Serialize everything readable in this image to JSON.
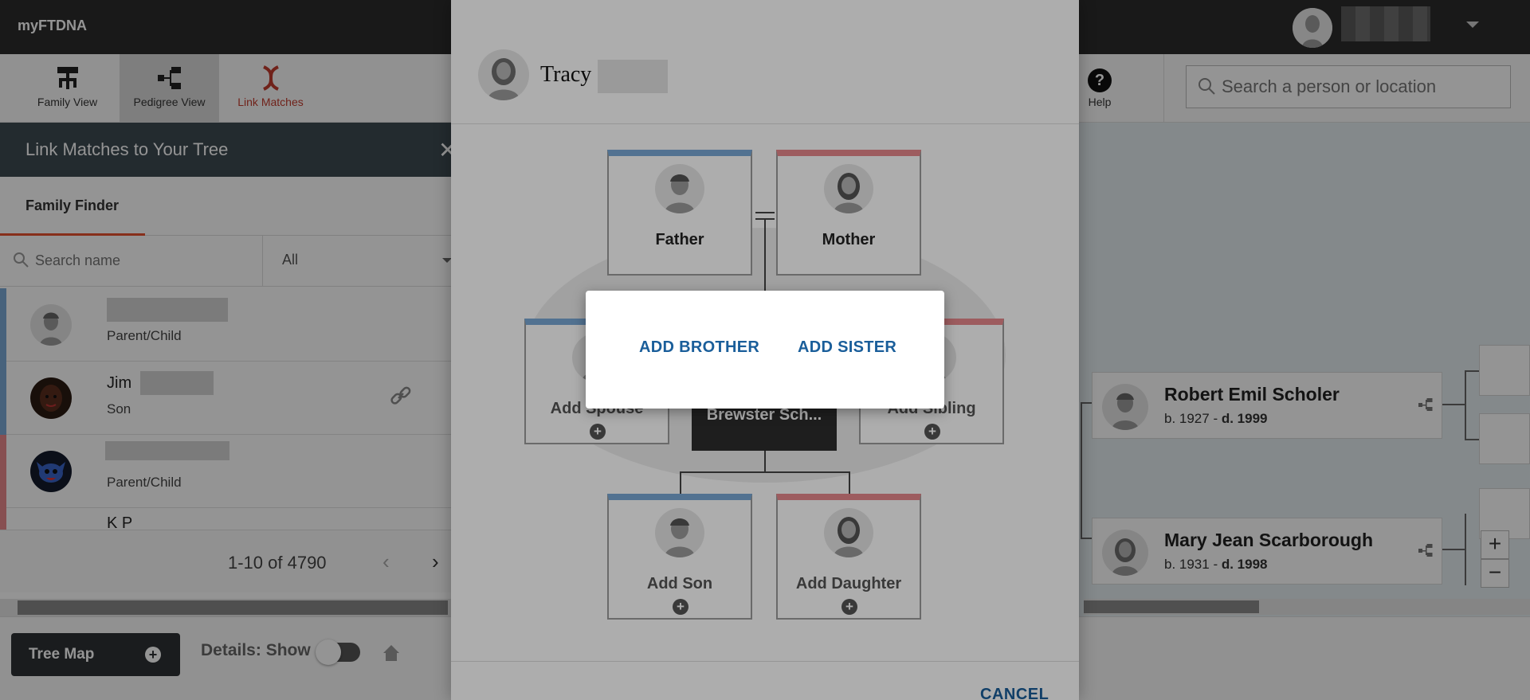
{
  "header": {
    "brand": "myFTDNA"
  },
  "toolbar": {
    "family_view": "Family View",
    "pedigree_view": "Pedigree View",
    "link_matches": "Link Matches",
    "help": "Help",
    "search_placeholder": "Search a person or location"
  },
  "left_panel": {
    "title": "Link Matches to Your Tree",
    "tab": "Family Finder",
    "name_search_placeholder": "Search name",
    "filter_value": "All",
    "matches": [
      {
        "name": "",
        "relationship": "Parent/Child"
      },
      {
        "name": "Jim",
        "relationship": "Son"
      },
      {
        "name": "",
        "relationship": "Parent/Child"
      },
      {
        "name": "K P",
        "relationship": ""
      }
    ],
    "pagination": "1-10 of 4790"
  },
  "tree": {
    "people": [
      {
        "name": "Robert Emil Scholer",
        "birth": "b. 1927 - ",
        "death": "d. 1999"
      },
      {
        "name": "Mary Jean Scarborough",
        "birth": "b. 1931 - ",
        "death": "d. 1998"
      }
    ],
    "zoom_in": "+",
    "zoom_out": "−"
  },
  "bottom_bar": {
    "tree_map": "Tree Map",
    "details": "Details: Show"
  },
  "modal": {
    "person_name": "Tracy",
    "father": "Father",
    "mother": "Mother",
    "add_spouse": "Add Spouse",
    "add_sibling": "Add Sibling",
    "focus_person": "Brewster Sch...",
    "add_son": "Add Son",
    "add_daughter": "Add Daughter",
    "cancel": "CANCEL"
  },
  "sibling_popup": {
    "add_brother": "ADD BROTHER",
    "add_sister": "ADD SISTER"
  },
  "colors": {
    "male": "#7aa9d6",
    "female": "#e8888c",
    "link_accent": "#1a5e9a",
    "active_tab": "#e8512f"
  }
}
